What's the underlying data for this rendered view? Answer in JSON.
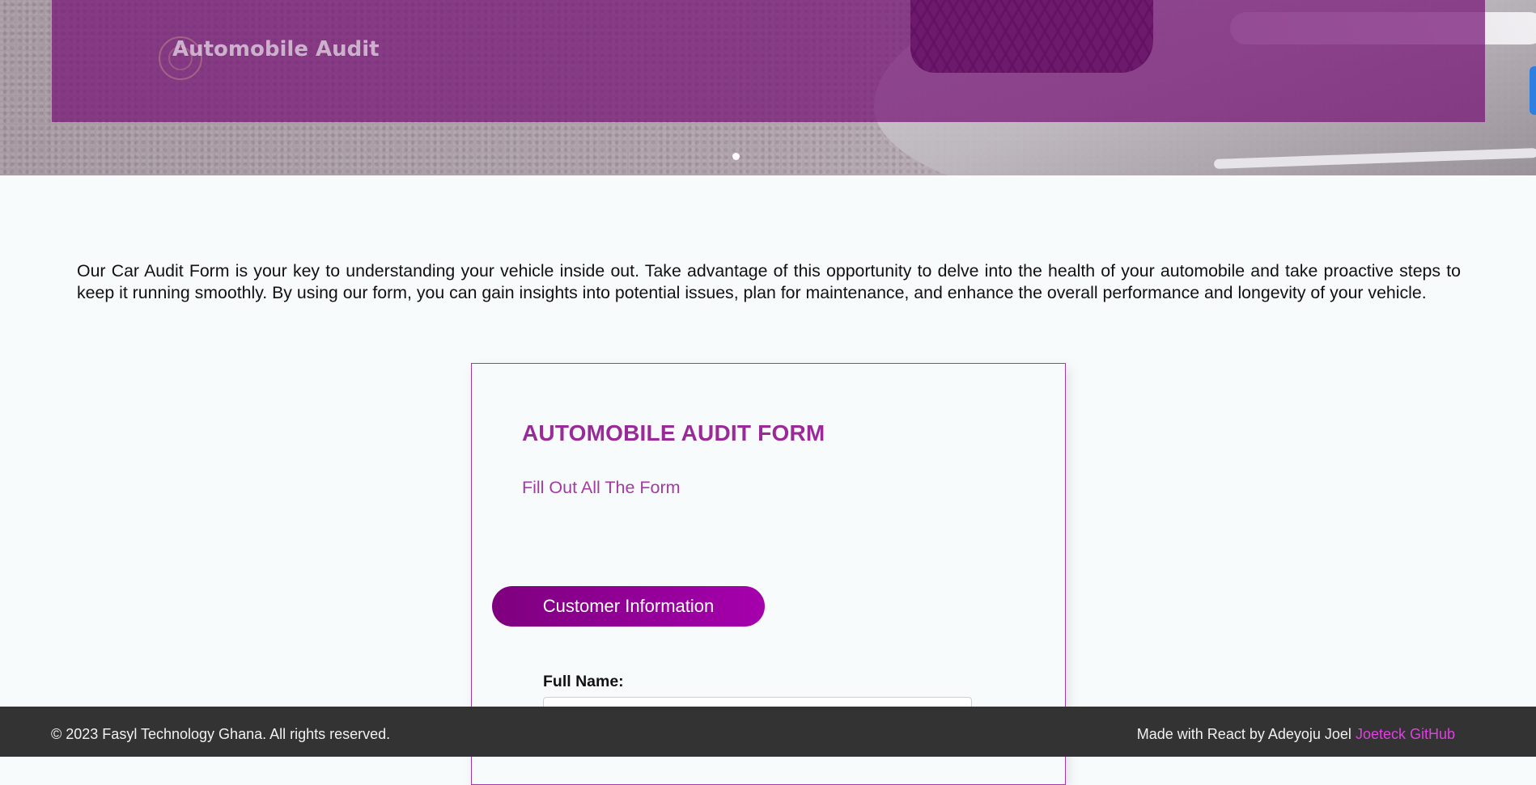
{
  "header": {
    "brand": "Automobile Audit"
  },
  "intro": {
    "text": "Our Car Audit Form is your key to understanding your vehicle inside out. Take advantage of this opportunity to delve into the health of your automobile and take proactive steps to keep it running smoothly. By using our form, you can gain insights into potential issues, plan for maintenance, and enhance the overall performance and longevity of your vehicle."
  },
  "form": {
    "title": "AUTOMOBILE AUDIT FORM",
    "subtitle": "Fill Out All The Form",
    "section_tab": "Customer Information",
    "fields": [
      {
        "label": "Full Name:",
        "value": "",
        "placeholder": ""
      }
    ]
  },
  "footer": {
    "copyright": "© 2023 Fasyl Technology Ghana. All rights reserved.",
    "made_with": "Made with React by Adeyoju Joel",
    "link_text": "Joeteck GitHub"
  },
  "colors": {
    "accent": "#9b2a99",
    "tab_gradient_start": "#7e007e",
    "tab_gradient_end": "#a500ad",
    "footer_bg": "#333333",
    "link": "#e040e0"
  }
}
